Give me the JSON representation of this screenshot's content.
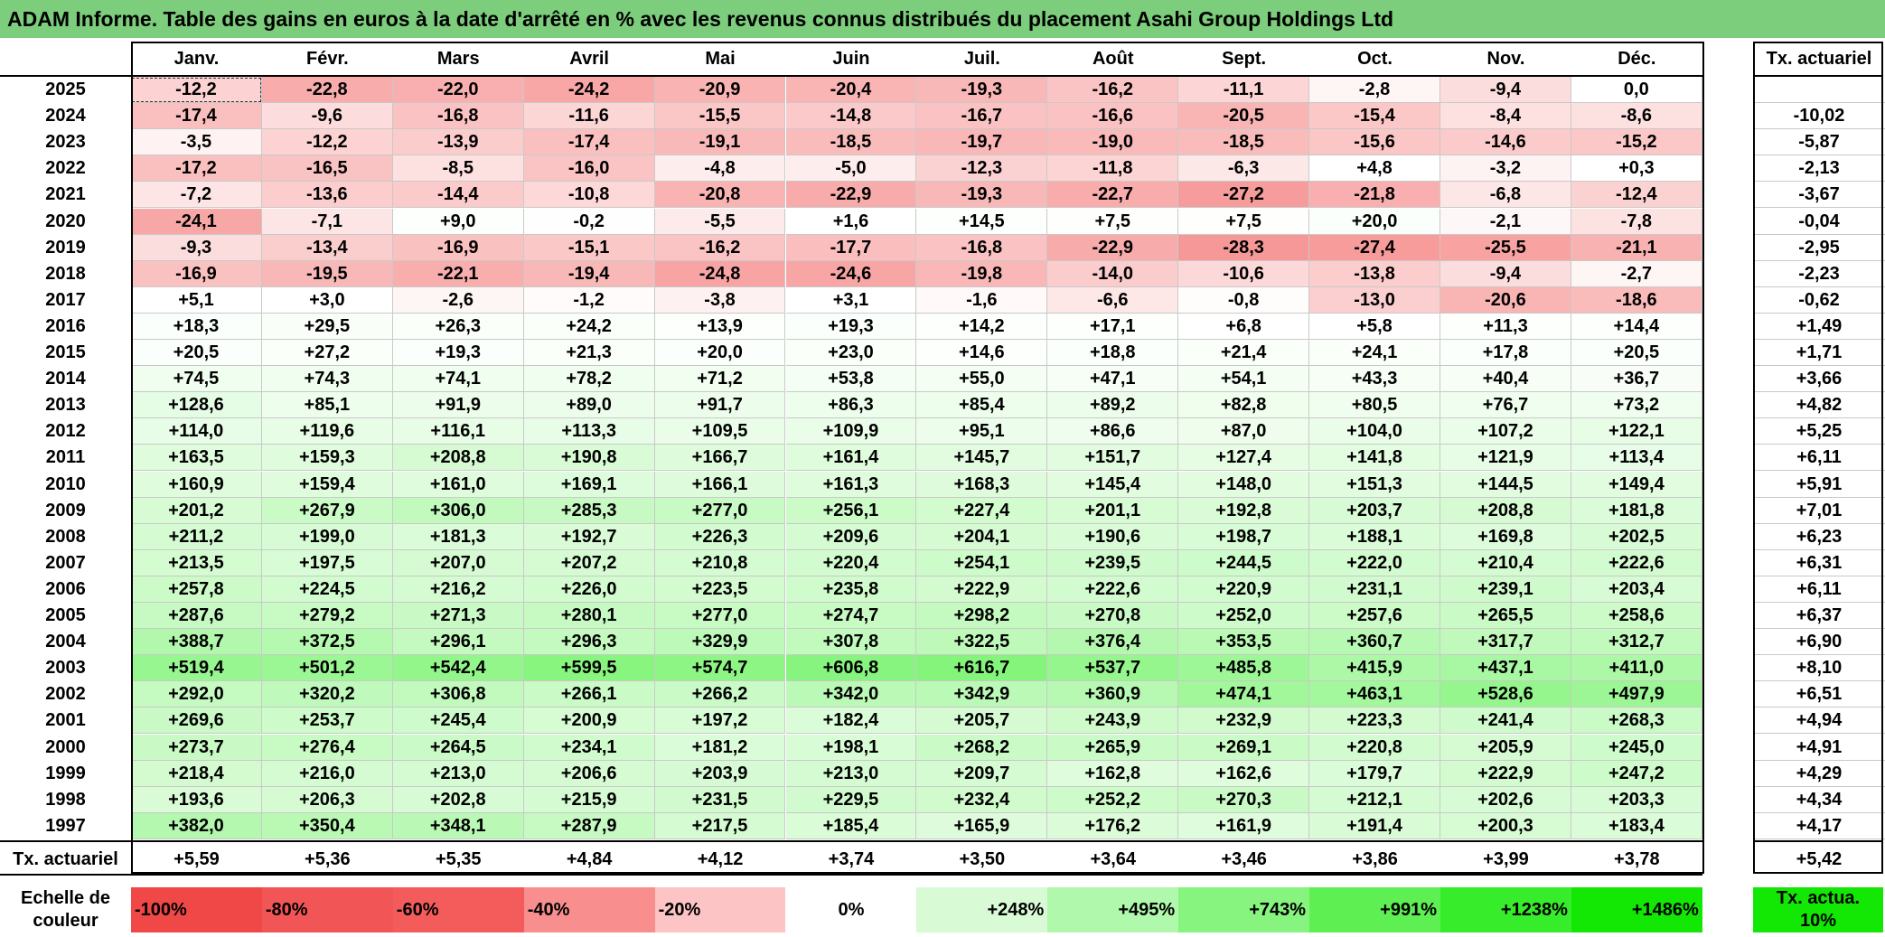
{
  "title": "ADAM Informe. Table des gains en euros à la date d'arrêté en % avec les revenus connus distribués du placement Asahi Group Holdings Ltd",
  "chart_data": {
    "type": "table",
    "columns": [
      "Janv.",
      "Févr.",
      "Mars",
      "Avril",
      "Mai",
      "Juin",
      "Juil.",
      "Août",
      "Sept.",
      "Oct.",
      "Nov.",
      "Déc."
    ],
    "tx_header": "Tx. actuariel",
    "rows": [
      {
        "year": "2025",
        "values": [
          "-12,2",
          "-22,8",
          "-22,0",
          "-24,2",
          "-20,9",
          "-20,4",
          "-19,3",
          "-16,2",
          "-11,1",
          "-2,8",
          "-9,4",
          "0,0"
        ],
        "tx": ""
      },
      {
        "year": "2024",
        "values": [
          "-17,4",
          "-9,6",
          "-16,8",
          "-11,6",
          "-15,5",
          "-14,8",
          "-16,7",
          "-16,6",
          "-20,5",
          "-15,4",
          "-8,4",
          "-8,6"
        ],
        "tx": "-10,02"
      },
      {
        "year": "2023",
        "values": [
          "-3,5",
          "-12,2",
          "-13,9",
          "-17,4",
          "-19,1",
          "-18,5",
          "-19,7",
          "-19,0",
          "-18,5",
          "-15,6",
          "-14,6",
          "-15,2"
        ],
        "tx": "-5,87"
      },
      {
        "year": "2022",
        "values": [
          "-17,2",
          "-16,5",
          "-8,5",
          "-16,0",
          "-4,8",
          "-5,0",
          "-12,3",
          "-11,8",
          "-6,3",
          "+4,8",
          "-3,2",
          "+0,3"
        ],
        "tx": "-2,13"
      },
      {
        "year": "2021",
        "values": [
          "-7,2",
          "-13,6",
          "-14,4",
          "-10,8",
          "-20,8",
          "-22,9",
          "-19,3",
          "-22,7",
          "-27,2",
          "-21,8",
          "-6,8",
          "-12,4"
        ],
        "tx": "-3,67"
      },
      {
        "year": "2020",
        "values": [
          "-24,1",
          "-7,1",
          "+9,0",
          "-0,2",
          "-5,5",
          "+1,6",
          "+14,5",
          "+7,5",
          "+7,5",
          "+20,0",
          "-2,1",
          "-7,8"
        ],
        "tx": "-0,04"
      },
      {
        "year": "2019",
        "values": [
          "-9,3",
          "-13,4",
          "-16,9",
          "-15,1",
          "-16,2",
          "-17,7",
          "-16,8",
          "-22,9",
          "-28,3",
          "-27,4",
          "-25,5",
          "-21,1"
        ],
        "tx": "-2,95"
      },
      {
        "year": "2018",
        "values": [
          "-16,9",
          "-19,5",
          "-22,1",
          "-19,4",
          "-24,8",
          "-24,6",
          "-19,8",
          "-14,0",
          "-10,6",
          "-13,8",
          "-9,4",
          "-2,7"
        ],
        "tx": "-2,23"
      },
      {
        "year": "2017",
        "values": [
          "+5,1",
          "+3,0",
          "-2,6",
          "-1,2",
          "-3,8",
          "+3,1",
          "-1,6",
          "-6,6",
          "-0,8",
          "-13,0",
          "-20,6",
          "-18,6"
        ],
        "tx": "-0,62"
      },
      {
        "year": "2016",
        "values": [
          "+18,3",
          "+29,5",
          "+26,3",
          "+24,2",
          "+13,9",
          "+19,3",
          "+14,2",
          "+17,1",
          "+6,8",
          "+5,8",
          "+11,3",
          "+14,4"
        ],
        "tx": "+1,49"
      },
      {
        "year": "2015",
        "values": [
          "+20,5",
          "+27,2",
          "+19,3",
          "+21,3",
          "+20,0",
          "+23,0",
          "+14,6",
          "+18,8",
          "+21,4",
          "+24,1",
          "+17,8",
          "+20,5"
        ],
        "tx": "+1,71"
      },
      {
        "year": "2014",
        "values": [
          "+74,5",
          "+74,3",
          "+74,1",
          "+78,2",
          "+71,2",
          "+53,8",
          "+55,0",
          "+47,1",
          "+54,1",
          "+43,3",
          "+40,4",
          "+36,7"
        ],
        "tx": "+3,66"
      },
      {
        "year": "2013",
        "values": [
          "+128,6",
          "+85,1",
          "+91,9",
          "+89,0",
          "+91,7",
          "+86,3",
          "+85,4",
          "+89,2",
          "+82,8",
          "+80,5",
          "+76,7",
          "+73,2"
        ],
        "tx": "+4,82"
      },
      {
        "year": "2012",
        "values": [
          "+114,0",
          "+119,6",
          "+116,1",
          "+113,3",
          "+109,5",
          "+109,9",
          "+95,1",
          "+86,6",
          "+87,0",
          "+104,0",
          "+107,2",
          "+122,1"
        ],
        "tx": "+5,25"
      },
      {
        "year": "2011",
        "values": [
          "+163,5",
          "+159,3",
          "+208,8",
          "+190,8",
          "+166,7",
          "+161,4",
          "+145,7",
          "+151,7",
          "+127,4",
          "+141,8",
          "+121,9",
          "+113,4"
        ],
        "tx": "+6,11"
      },
      {
        "year": "2010",
        "values": [
          "+160,9",
          "+159,4",
          "+161,0",
          "+169,1",
          "+166,1",
          "+161,3",
          "+168,3",
          "+145,4",
          "+148,0",
          "+151,3",
          "+144,5",
          "+149,4"
        ],
        "tx": "+5,91"
      },
      {
        "year": "2009",
        "values": [
          "+201,2",
          "+267,9",
          "+306,0",
          "+285,3",
          "+277,0",
          "+256,1",
          "+227,4",
          "+201,1",
          "+192,8",
          "+203,7",
          "+208,8",
          "+181,8"
        ],
        "tx": "+7,01"
      },
      {
        "year": "2008",
        "values": [
          "+211,2",
          "+199,0",
          "+181,3",
          "+192,7",
          "+226,3",
          "+209,6",
          "+204,1",
          "+190,6",
          "+198,7",
          "+188,1",
          "+169,8",
          "+202,5"
        ],
        "tx": "+6,23"
      },
      {
        "year": "2007",
        "values": [
          "+213,5",
          "+197,5",
          "+207,0",
          "+207,2",
          "+210,8",
          "+220,4",
          "+254,1",
          "+239,5",
          "+244,5",
          "+222,0",
          "+210,4",
          "+222,6"
        ],
        "tx": "+6,31"
      },
      {
        "year": "2006",
        "values": [
          "+257,8",
          "+224,5",
          "+216,2",
          "+226,0",
          "+223,5",
          "+235,8",
          "+222,9",
          "+222,6",
          "+220,9",
          "+231,1",
          "+239,1",
          "+203,4"
        ],
        "tx": "+6,11"
      },
      {
        "year": "2005",
        "values": [
          "+287,6",
          "+279,2",
          "+271,3",
          "+280,1",
          "+277,0",
          "+274,7",
          "+298,2",
          "+270,8",
          "+252,0",
          "+257,6",
          "+265,5",
          "+258,6"
        ],
        "tx": "+6,37"
      },
      {
        "year": "2004",
        "values": [
          "+388,7",
          "+372,5",
          "+296,1",
          "+296,3",
          "+329,9",
          "+307,8",
          "+322,5",
          "+376,4",
          "+353,5",
          "+360,7",
          "+317,7",
          "+312,7"
        ],
        "tx": "+6,90"
      },
      {
        "year": "2003",
        "values": [
          "+519,4",
          "+501,2",
          "+542,4",
          "+599,5",
          "+574,7",
          "+606,8",
          "+616,7",
          "+537,7",
          "+485,8",
          "+415,9",
          "+437,1",
          "+411,0"
        ],
        "tx": "+8,10"
      },
      {
        "year": "2002",
        "values": [
          "+292,0",
          "+320,2",
          "+306,8",
          "+266,1",
          "+266,2",
          "+342,0",
          "+342,9",
          "+360,9",
          "+474,1",
          "+463,1",
          "+528,6",
          "+497,9"
        ],
        "tx": "+6,51"
      },
      {
        "year": "2001",
        "values": [
          "+269,6",
          "+253,7",
          "+245,4",
          "+200,9",
          "+197,2",
          "+182,4",
          "+205,7",
          "+243,9",
          "+232,9",
          "+223,3",
          "+241,4",
          "+268,3"
        ],
        "tx": "+4,94"
      },
      {
        "year": "2000",
        "values": [
          "+273,7",
          "+276,4",
          "+264,5",
          "+234,1",
          "+181,2",
          "+198,1",
          "+268,2",
          "+265,9",
          "+269,1",
          "+220,8",
          "+205,9",
          "+245,0"
        ],
        "tx": "+4,91"
      },
      {
        "year": "1999",
        "values": [
          "+218,4",
          "+216,0",
          "+213,0",
          "+206,6",
          "+203,9",
          "+213,0",
          "+209,7",
          "+162,8",
          "+162,6",
          "+179,7",
          "+222,9",
          "+247,2"
        ],
        "tx": "+4,29"
      },
      {
        "year": "1998",
        "values": [
          "+193,6",
          "+206,3",
          "+202,8",
          "+215,9",
          "+231,5",
          "+229,5",
          "+232,4",
          "+252,2",
          "+270,3",
          "+212,1",
          "+202,6",
          "+203,3"
        ],
        "tx": "+4,34"
      },
      {
        "year": "1997",
        "values": [
          "+382,0",
          "+350,4",
          "+348,1",
          "+287,9",
          "+217,5",
          "+185,4",
          "+165,9",
          "+176,2",
          "+161,9",
          "+191,4",
          "+200,3",
          "+183,4"
        ],
        "tx": "+4,17"
      }
    ],
    "footer": {
      "label": "Tx. actuariel",
      "values": [
        "+5,59",
        "+5,36",
        "+5,35",
        "+4,84",
        "+4,12",
        "+3,74",
        "+3,50",
        "+3,64",
        "+3,46",
        "+3,86",
        "+3,99",
        "+3,78"
      ],
      "tx": "+5,42"
    },
    "legend": {
      "label": "Echelle de couleur",
      "items": [
        {
          "text": "-100%",
          "color": "#f04747"
        },
        {
          "text": "-80%",
          "color": "#f25555"
        },
        {
          "text": "-60%",
          "color": "#f45c5c"
        },
        {
          "text": "-40%",
          "color": "#f98e8e"
        },
        {
          "text": "-20%",
          "color": "#fcc4c4"
        },
        {
          "text": "0%",
          "color": "#ffffff"
        },
        {
          "text": "+248%",
          "color": "#d8fbd6"
        },
        {
          "text": "+495%",
          "color": "#b0f8ab"
        },
        {
          "text": "+743%",
          "color": "#86f47e"
        },
        {
          "text": "+991%",
          "color": "#5ef053"
        },
        {
          "text": "+1238%",
          "color": "#37ec2a"
        },
        {
          "text": "+1486%",
          "color": "#12e803"
        }
      ],
      "tx_label": "Tx. actua. 10%",
      "tx_color": "#12e803"
    }
  }
}
